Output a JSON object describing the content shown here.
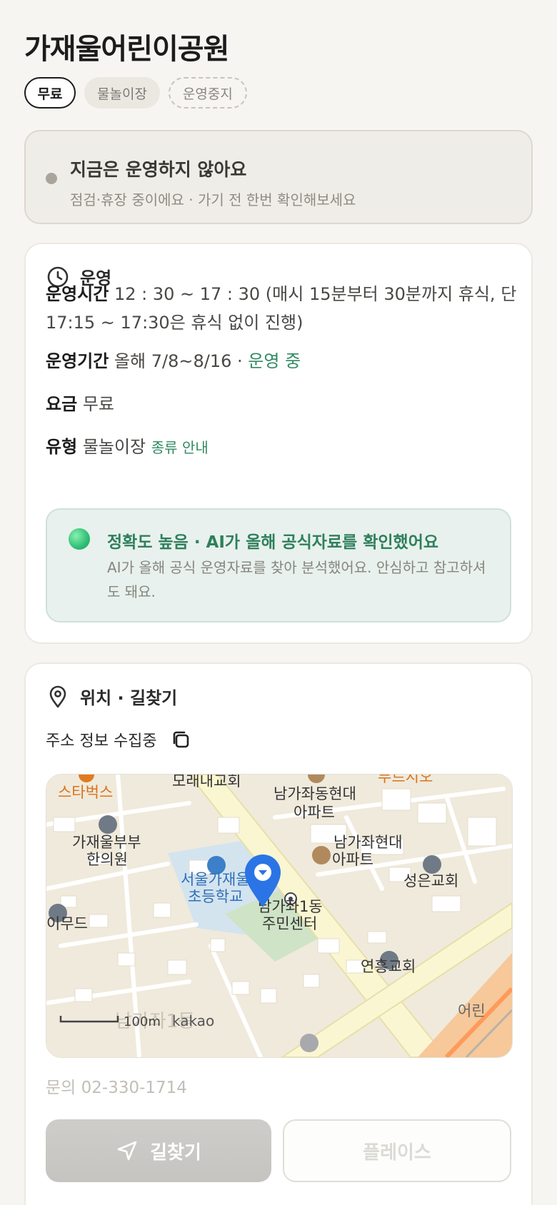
{
  "title": "가재울어린이공원",
  "tags": {
    "fee": "무료",
    "type": "물놀이장",
    "status": "운영중지"
  },
  "notice": {
    "title": "지금은 운영하지 않아요",
    "subtitle": "점검·휴장 중이에요 · 가기 전 한번 확인해보세요"
  },
  "operation": {
    "section_title": "운영",
    "hours_label": "운영시간",
    "hours_value": "12 : 30 ~ 17 : 30 (매시 15분부터 30분까지 휴식, 단 17:15 ~ 17:30은 휴식 없이 진행)",
    "period_label": "운영기간",
    "period_value": "올해 7/8~8/16 · ",
    "period_status": "운영 중",
    "fee_label": "요금",
    "fee_value": "무료",
    "type_label": "유형",
    "type_value": "물놀이장",
    "type_link": "종류 안내"
  },
  "ai": {
    "title": "정확도 높음 · AI가 올해 공식자료를 확인했어요",
    "desc": "AI가 올해 공식 운영자료를 찾아 분석했어요. 안심하고 참고하셔도 돼요."
  },
  "location": {
    "section_title": "위치 · 길찾기",
    "address": "주소 정보 수집중",
    "map": {
      "labels": {
        "starbucks": "스타벅스",
        "church1": "모래내교회",
        "apt1a": "남가좌동현대",
        "apt1b": "아파트",
        "apt2a": "남가좌현대",
        "apt2b": "아파트",
        "church2": "성은교회",
        "clinic_a": "가재울부부",
        "clinic_b": "한의원",
        "school_a": "서울가재울",
        "school_b": "초등학교",
        "center_a": "남가좌1동",
        "center_b": "주민센터",
        "imud": "이무드",
        "church3": "연흥교회",
        "district": "남가좌1동",
        "top_right": "푸르지오",
        "edge": "어린",
        "scale": "100m",
        "brand": "kakao"
      }
    }
  },
  "contact": "문의 02-330-1714",
  "buttons": {
    "route": "길찾기",
    "place": "플레이스"
  }
}
